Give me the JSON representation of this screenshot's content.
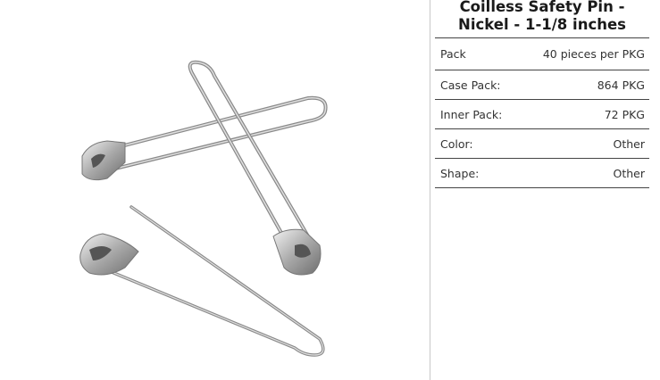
{
  "product": {
    "title_line1": "Coilless Safety Pin -",
    "title_line2": "Nickel - 1-1/8 inches",
    "image_alt": "Safety pins",
    "metal_color": "#b8b8b8"
  },
  "specs": [
    {
      "label": "Pack",
      "value": "40 pieces per PKG"
    },
    {
      "label": "Case Pack:",
      "value": "864 PKG"
    },
    {
      "label": "Inner Pack:",
      "value": "72 PKG"
    },
    {
      "label": "Color:",
      "value": "Other"
    },
    {
      "label": "Shape:",
      "value": "Other"
    }
  ]
}
